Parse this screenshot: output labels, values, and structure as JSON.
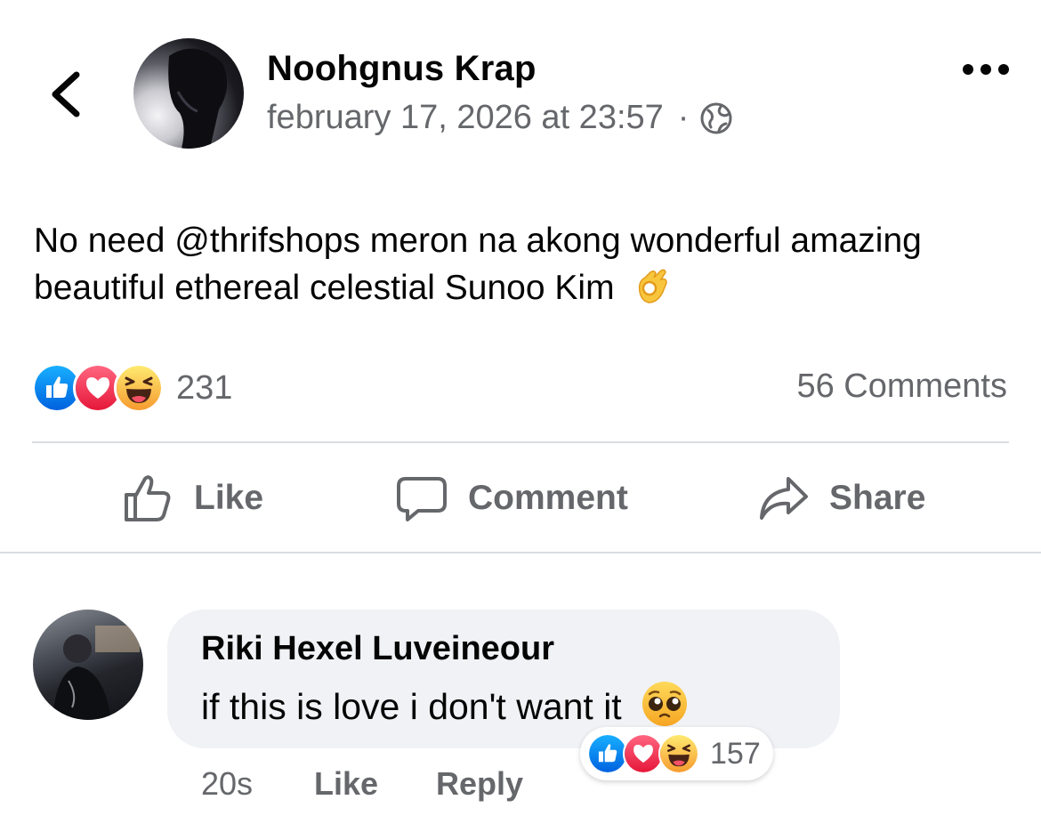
{
  "header": {
    "back_icon": "chevron-left-icon",
    "author_name": "Noohgnus Krap",
    "timestamp": "february 17, 2026 at 23:57",
    "separator": "·",
    "privacy_icon": "globe-icon",
    "more_icon": "more-dots-icon"
  },
  "post": {
    "text": "No need @thrifshops meron na akong wonderful amazing beautiful ethereal celestial Sunoo Kim",
    "emoji": "ok-hand-emoji"
  },
  "reactions": {
    "icons": [
      "like-reaction-icon",
      "love-reaction-icon",
      "haha-reaction-icon"
    ],
    "count": "231",
    "comments_label": "56 Comments"
  },
  "actions": {
    "like_label": "Like",
    "comment_label": "Comment",
    "share_label": "Share"
  },
  "comment": {
    "author": "Riki Hexel Luveineour",
    "text": "if this is love i don't want it",
    "emoji": "pleading-face-emoji",
    "reaction_count": "157",
    "time": "20s",
    "like_label": "Like",
    "reply_label": "Reply"
  },
  "colors": {
    "like_blue": "#1877f2",
    "love_red": "#f33e58",
    "haha_yellow": "#f7b125",
    "secondary_text": "#65676b",
    "bubble_bg": "#f0f2f5"
  }
}
